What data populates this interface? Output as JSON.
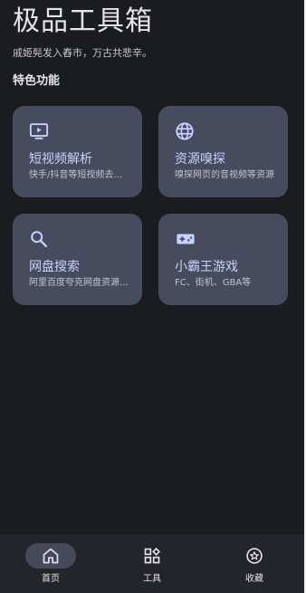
{
  "header": {
    "title": "极品工具箱",
    "subtitle": "戚姬髡发入舂市，万古共悲辛。"
  },
  "features": {
    "section_title": "特色功能",
    "cards": [
      {
        "icon": "tv-play-icon",
        "title": "短视频解析",
        "desc": "快手/抖音等短视频去水印"
      },
      {
        "icon": "globe-icon",
        "title": "资源嗅探",
        "desc": "嗅探网页的音视频等资源"
      },
      {
        "icon": "search-icon",
        "title": "网盘搜索",
        "desc": "阿里百度夸克网盘资源搜索"
      },
      {
        "icon": "gamepad-icon",
        "title": "小霸王游戏",
        "desc": "FC、街机、GBA等"
      }
    ]
  },
  "bottom_nav": {
    "active": 0,
    "items": [
      {
        "label": "首页",
        "icon": "home-icon"
      },
      {
        "label": "工具",
        "icon": "apps-icon"
      },
      {
        "label": "收藏",
        "icon": "star-icon"
      }
    ]
  },
  "colors": {
    "background": "#1b1c20",
    "card": "#474b5e",
    "accent_text": "#c8d2ff",
    "nav_background": "#24252b",
    "nav_active_pill": "#46495a"
  }
}
